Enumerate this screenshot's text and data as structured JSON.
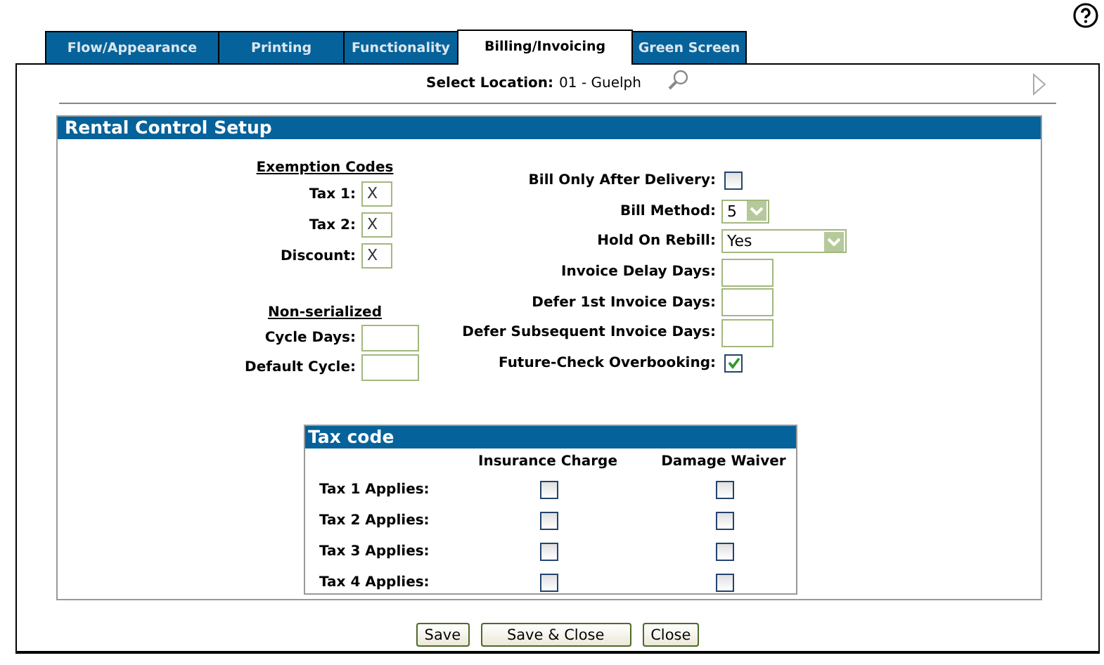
{
  "tabs": [
    {
      "label": "Flow/Appearance",
      "selected": false
    },
    {
      "label": "Printing",
      "selected": false
    },
    {
      "label": "Functionality",
      "selected": false
    },
    {
      "label": "Billing/Invoicing",
      "selected": true
    },
    {
      "label": "Green Screen",
      "selected": false
    }
  ],
  "location": {
    "label": "Select Location:",
    "value": "01 - Guelph"
  },
  "section": {
    "title": "Rental Control Setup"
  },
  "exemption_codes": {
    "heading": "Exemption Codes",
    "fields": [
      {
        "label": "Tax 1:",
        "value": "X"
      },
      {
        "label": "Tax 2:",
        "value": "X"
      },
      {
        "label": "Discount:",
        "value": "X"
      }
    ]
  },
  "non_serialized": {
    "heading": "Non-serialized",
    "fields": [
      {
        "label": "Cycle Days:"
      },
      {
        "label": "Default Cycle:"
      }
    ]
  },
  "options": [
    {
      "kind": "checkbox",
      "label": "Bill Only After Delivery:",
      "checked": false
    },
    {
      "kind": "select",
      "label": "Bill Method:",
      "value": "5"
    },
    {
      "kind": "select",
      "label": "Hold On Rebill:",
      "value": "Yes"
    },
    {
      "kind": "input",
      "label": "Invoice Delay Days:"
    },
    {
      "kind": "input",
      "label": "Defer 1st Invoice Days:"
    },
    {
      "kind": "input",
      "label": "Defer Subsequent Invoice Days:"
    },
    {
      "kind": "checkbox",
      "label": "Future-Check Overbooking:",
      "checked": true
    }
  ],
  "tax_code": {
    "title": "Tax code",
    "columns": [
      "Insurance Charge",
      "Damage Waiver"
    ],
    "rows": [
      {
        "label": "Tax 1 Applies:",
        "checks": [
          false,
          false
        ]
      },
      {
        "label": "Tax 2 Applies:",
        "checks": [
          false,
          false
        ]
      },
      {
        "label": "Tax 3 Applies:",
        "checks": [
          false,
          false
        ]
      },
      {
        "label": "Tax 4 Applies:",
        "checks": [
          false,
          false
        ]
      }
    ]
  },
  "buttons": [
    "Save",
    "Save & Close",
    "Close"
  ]
}
